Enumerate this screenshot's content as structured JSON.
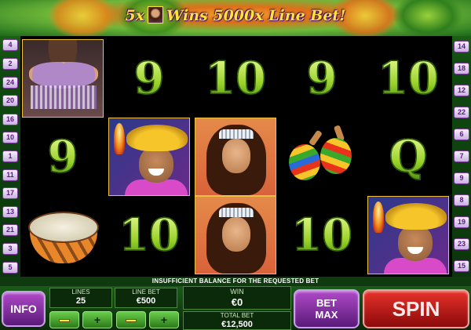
{
  "banner": {
    "prefix": "5x",
    "suffix": "Wins 5000x Line Bet!"
  },
  "line_numbers": {
    "left": [
      "4",
      "2",
      "24",
      "20",
      "16",
      "10",
      "1",
      "11",
      "17",
      "13",
      "21",
      "3",
      "5"
    ],
    "right": [
      "14",
      "18",
      "12",
      "22",
      "6",
      "7",
      "9",
      "8",
      "19",
      "23",
      "15"
    ]
  },
  "reels": [
    [
      {
        "symbol": "bellydancer"
      },
      {
        "symbol": "9"
      },
      {
        "symbol": "drum"
      }
    ],
    [
      {
        "symbol": "9"
      },
      {
        "symbol": "mariachi"
      },
      {
        "symbol": "10"
      }
    ],
    [
      {
        "symbol": "10"
      },
      {
        "symbol": "lady"
      },
      {
        "symbol": "lady"
      }
    ],
    [
      {
        "symbol": "9"
      },
      {
        "symbol": "maracas"
      },
      {
        "symbol": "10"
      }
    ],
    [
      {
        "symbol": "10"
      },
      {
        "symbol": "Q"
      },
      {
        "symbol": "mariachi"
      }
    ]
  ],
  "message": "INSUFFICIENT BALANCE FOR THE REQUESTED BET",
  "controls": {
    "info_label": "INFO",
    "lines_label": "LINES",
    "lines_value": "25",
    "line_bet_label": "LINE BET",
    "line_bet_value": "€500",
    "win_label": "WIN",
    "win_value": "€0",
    "total_bet_label": "TOTAL BET",
    "total_bet_value": "€12,500",
    "bet_max_label_1": "BET",
    "bet_max_label_2": "MAX",
    "spin_label": "SPIN",
    "plus_label": "+"
  },
  "colors": {
    "accent_gold": "#ffe23a",
    "spin_red": "#e8322a",
    "panel_purple": "#b04ac8"
  }
}
